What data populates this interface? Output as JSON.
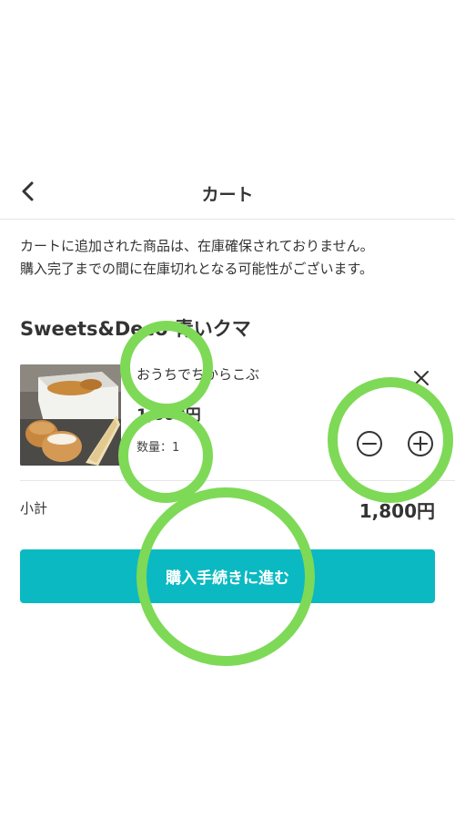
{
  "header": {
    "title": "カート",
    "back_icon": "chevron-left-icon"
  },
  "notice": {
    "line1": "カートに追加された商品は、在庫確保されておりません。",
    "line2": "購入完了までの間に在庫切れとなる可能性がございます。"
  },
  "shop": {
    "name": "Sweets&Deco 青いクマ"
  },
  "item": {
    "name": "おうちでちからこぶ",
    "price": "1,800円",
    "quantity_label": "数量：1",
    "quantity": 1,
    "image": "cream-puff-box-photo",
    "remove_icon": "close-icon",
    "decrement_icon": "minus-circle-icon",
    "increment_icon": "plus-circle-icon"
  },
  "summary": {
    "subtotal_label": "小計",
    "subtotal_value": "1,800円"
  },
  "checkout": {
    "label": "購入手続きに進む"
  },
  "colors": {
    "accent": "#0bb9c2",
    "annotation": "#7ed957",
    "text": "#333333",
    "divider": "#e3e3e3"
  }
}
